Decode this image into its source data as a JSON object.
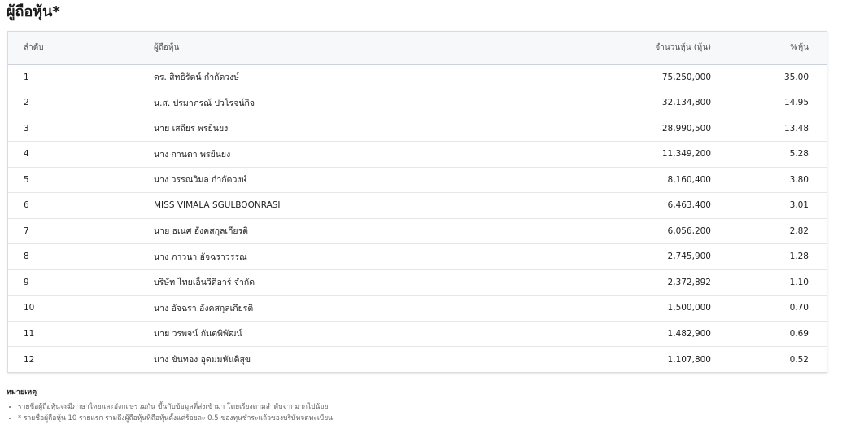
{
  "page": {
    "title": "ผู้ถือหุ้น*"
  },
  "table": {
    "headers": {
      "rank": "ลำดับ",
      "name": "ผู้ถือหุ้น",
      "shares": "จำนวนหุ้น (หุ้น)",
      "percent": "%หุ้น"
    },
    "rows": [
      {
        "rank": "1",
        "name": "ดร. สิทธิรัตน์ กำกัดวงษ์",
        "shares": "75,250,000",
        "percent": "35.00"
      },
      {
        "rank": "2",
        "name": "น.ส. ปรมาภรณ์ ปวโรจน์กิจ",
        "shares": "32,134,800",
        "percent": "14.95"
      },
      {
        "rank": "3",
        "name": "นาย เสถียร พรยืนยง",
        "shares": "28,990,500",
        "percent": "13.48"
      },
      {
        "rank": "4",
        "name": "นาง กานดา พรยืนยง",
        "shares": "11,349,200",
        "percent": "5.28"
      },
      {
        "rank": "5",
        "name": "นาง วรรณวิมล กำกัดวงษ์",
        "shares": "8,160,400",
        "percent": "3.80"
      },
      {
        "rank": "6",
        "name": "MISS VIMALA SGULBOONRASI",
        "shares": "6,463,400",
        "percent": "3.01"
      },
      {
        "rank": "7",
        "name": "นาย ธเนศ อังคสกุลเกียรติ",
        "shares": "6,056,200",
        "percent": "2.82"
      },
      {
        "rank": "8",
        "name": "นาง ภาวนา อัจฉราวรรณ",
        "shares": "2,745,900",
        "percent": "1.28"
      },
      {
        "rank": "9",
        "name": "บริษัท ไทยเอ็นวีดีอาร์ จำกัด",
        "shares": "2,372,892",
        "percent": "1.10"
      },
      {
        "rank": "10",
        "name": "นาง อัจฉรา อังคสกุลเกียรติ",
        "shares": "1,500,000",
        "percent": "0.70"
      },
      {
        "rank": "11",
        "name": "นาย วรพจน์ กันตพิพัฒน์",
        "shares": "1,482,900",
        "percent": "0.69"
      },
      {
        "rank": "12",
        "name": "นาง ขันทอง อุดมมหันติสุข",
        "shares": "1,107,800",
        "percent": "0.52"
      }
    ]
  },
  "notes": {
    "title": "หมายเหตุ",
    "items": [
      "รายชื่อผู้ถือหุ้นจะมีภาษาไทยและอังกฤษรวมกัน ขึ้นกับข้อมูลที่ส่งเข้ามา โดยเรียงตามลำดับจากมากไปน้อย",
      "* รายชื่อผู้ถือหุ้น 10 รายแรก รวมถึงผู้ถือหุ้นที่ถือหุ้นตั้งแต่ร้อยละ 0.5 ของทุนชำระแล้วของบริษัทจดทะเบียน"
    ]
  }
}
